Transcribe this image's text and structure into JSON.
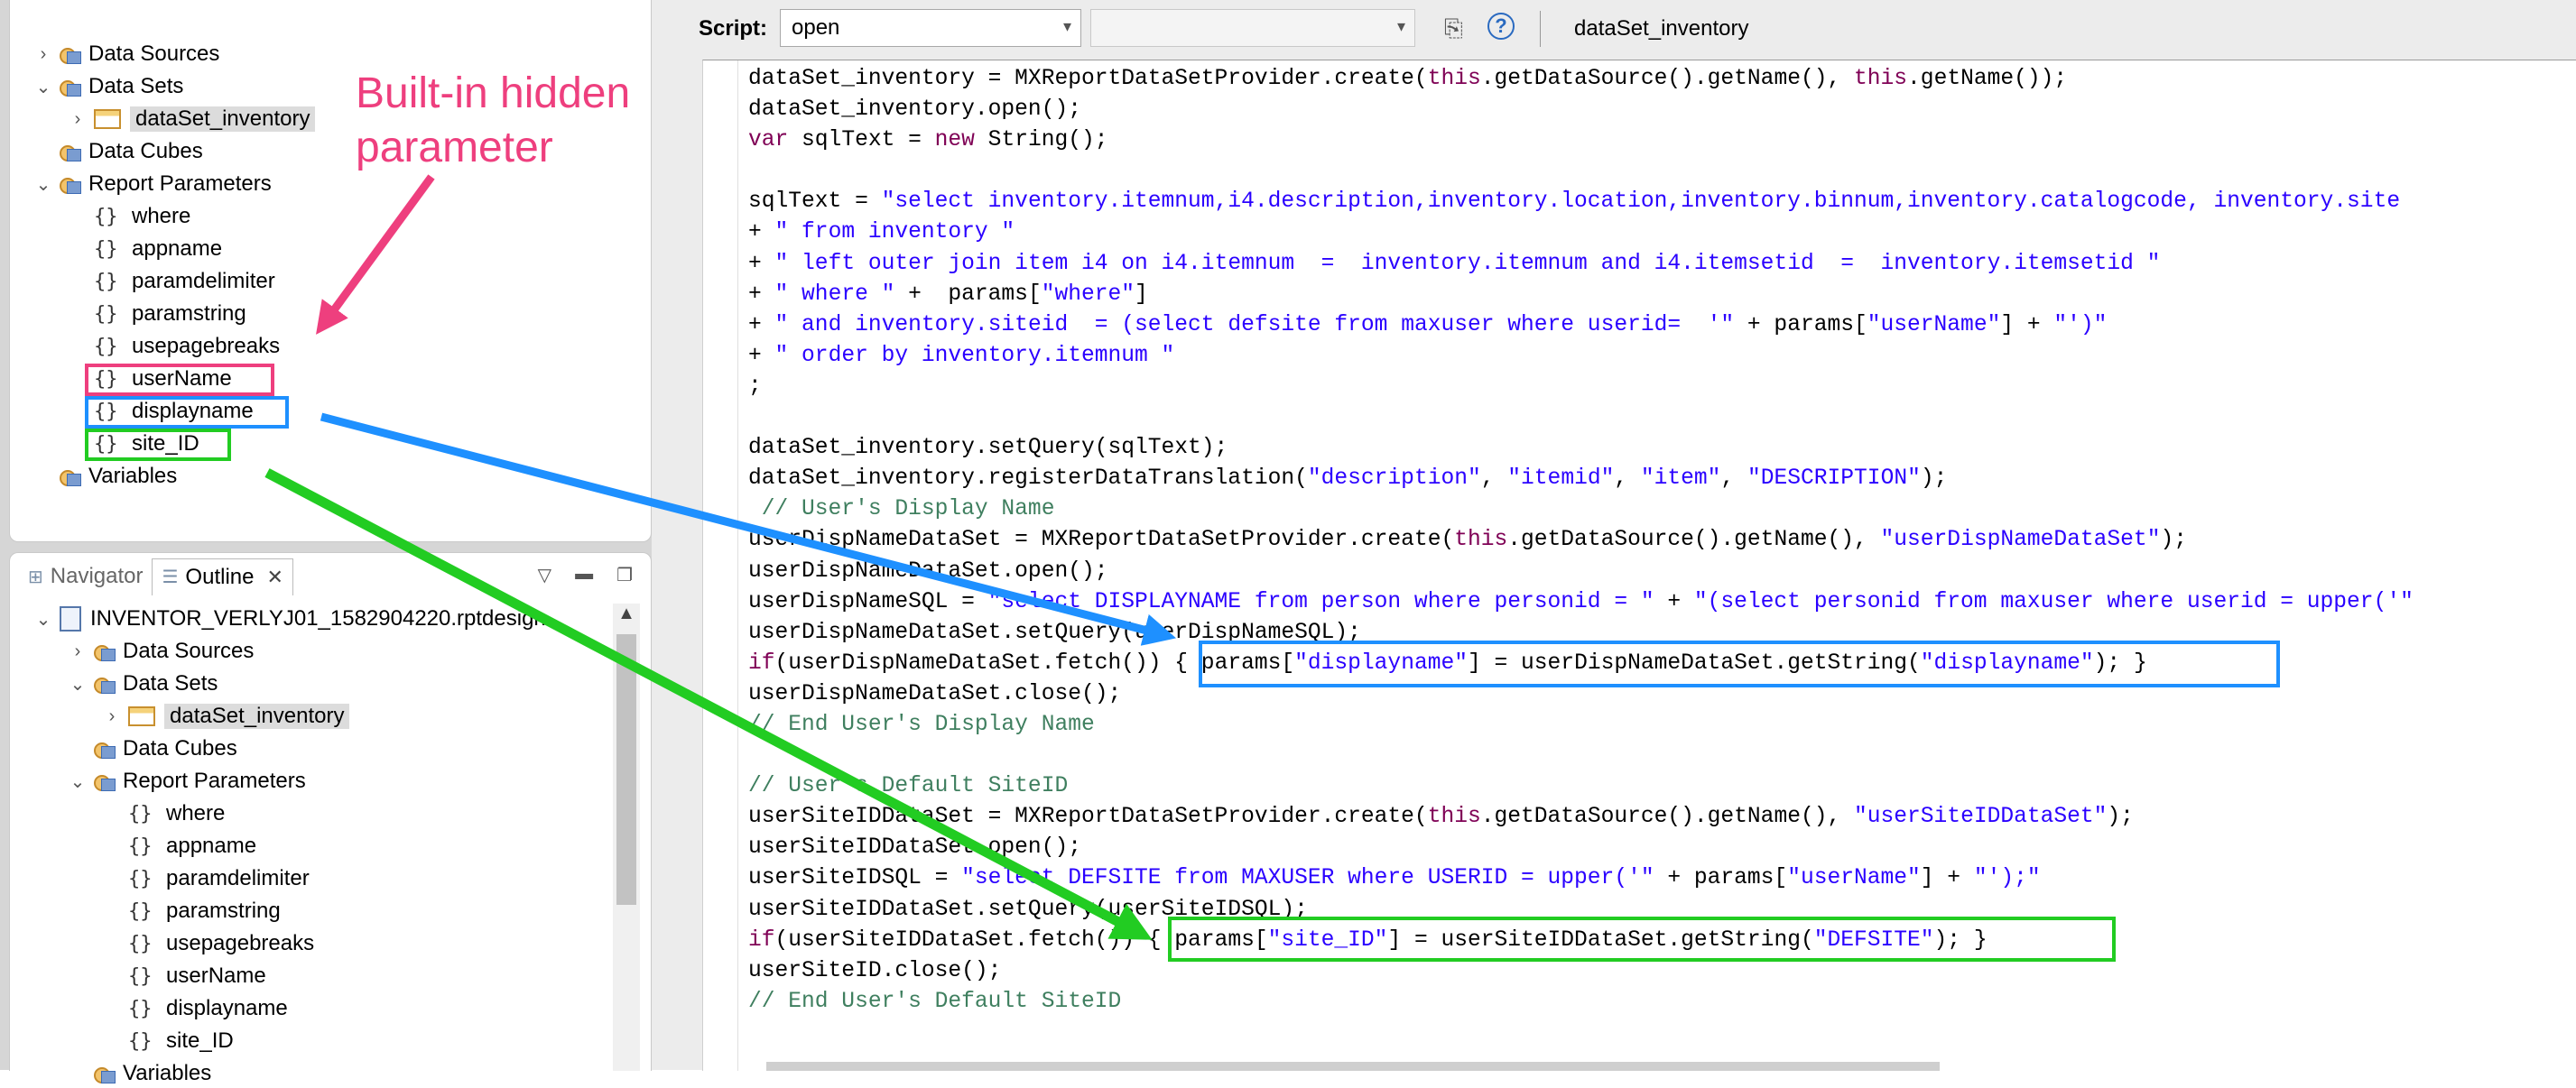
{
  "left_tree": {
    "items": [
      {
        "label": "Data Sources",
        "icon": "data-source-icon",
        "expander": "collapsed"
      },
      {
        "label": "Data Sets",
        "icon": "data-sets-icon",
        "expander": "expanded"
      },
      {
        "label": "dataSet_inventory",
        "icon": "table-icon",
        "expander": "collapsed",
        "selected": true
      },
      {
        "label": "Data Cubes",
        "icon": "data-cube-icon"
      },
      {
        "label": "Report Parameters",
        "icon": "report-parameters-icon",
        "expander": "expanded"
      },
      {
        "label": "where",
        "icon": "parameter-icon"
      },
      {
        "label": "appname",
        "icon": "parameter-icon"
      },
      {
        "label": "paramdelimiter",
        "icon": "parameter-icon"
      },
      {
        "label": "paramstring",
        "icon": "parameter-icon"
      },
      {
        "label": "usepagebreaks",
        "icon": "parameter-icon"
      },
      {
        "label": "userName",
        "icon": "parameter-icon",
        "highlight": "#ee3f7e"
      },
      {
        "label": "displayname",
        "icon": "parameter-icon",
        "highlight": "#1e90ff"
      },
      {
        "label": "site_ID",
        "icon": "parameter-icon",
        "highlight": "#22cc22"
      },
      {
        "label": "Variables",
        "icon": "variables-icon"
      }
    ]
  },
  "annotation": {
    "line1": "Built-in hidden",
    "line2": "parameter",
    "color": "#ee3f7e"
  },
  "nav_panel": {
    "tabs": [
      {
        "label": "Navigator",
        "icon": "navigator-icon",
        "active": false
      },
      {
        "label": "Outline",
        "icon": "outline-icon",
        "active": true,
        "close": "✕"
      }
    ],
    "tree": [
      {
        "label": "INVENTOR_VERLYJ01_1582904220.rptdesign",
        "icon": "report-file-icon",
        "expander": "expanded"
      },
      {
        "label": "Data Sources",
        "icon": "data-source-icon",
        "expander": "collapsed"
      },
      {
        "label": "Data Sets",
        "icon": "data-sets-icon",
        "expander": "expanded"
      },
      {
        "label": "dataSet_inventory",
        "icon": "table-icon",
        "expander": "collapsed",
        "selected": true
      },
      {
        "label": "Data Cubes",
        "icon": "data-cube-icon"
      },
      {
        "label": "Report Parameters",
        "icon": "report-parameters-icon",
        "expander": "expanded"
      },
      {
        "label": "where",
        "icon": "parameter-icon"
      },
      {
        "label": "appname",
        "icon": "parameter-icon"
      },
      {
        "label": "paramdelimiter",
        "icon": "parameter-icon"
      },
      {
        "label": "paramstring",
        "icon": "parameter-icon"
      },
      {
        "label": "usepagebreaks",
        "icon": "parameter-icon"
      },
      {
        "label": "userName",
        "icon": "parameter-icon"
      },
      {
        "label": "displayname",
        "icon": "parameter-icon"
      },
      {
        "label": "site_ID",
        "icon": "parameter-icon"
      },
      {
        "label": "Variables",
        "icon": "variables-icon"
      }
    ]
  },
  "toolbar": {
    "script_label": "Script:",
    "script_value": "open",
    "method_value": "",
    "dataset_name": "dataSet_inventory",
    "help_glyph": "?"
  },
  "code_lines": [
    [
      {
        "t": "dataSet_inventory = MXReportDataSetProvider.create("
      },
      {
        "t": "this",
        "c": "kw"
      },
      {
        "t": ".getDataSource().getName(), "
      },
      {
        "t": "this",
        "c": "kw"
      },
      {
        "t": ".getName());"
      }
    ],
    [
      {
        "t": "dataSet_inventory.open();"
      }
    ],
    [
      {
        "t": "var",
        "c": "kw"
      },
      {
        "t": " sqlText = "
      },
      {
        "t": "new",
        "c": "kw"
      },
      {
        "t": " String();"
      }
    ],
    [],
    [
      {
        "t": "sqlText = "
      },
      {
        "t": "\"select inventory.itemnum,i4.description,inventory.location,inventory.binnum,inventory.catalogcode, inventory.site",
        "c": "str"
      }
    ],
    [
      {
        "t": "+ "
      },
      {
        "t": "\" from inventory \"",
        "c": "str"
      }
    ],
    [
      {
        "t": "+ "
      },
      {
        "t": "\" left outer join item i4 on i4.itemnum  =  inventory.itemnum and i4.itemsetid  =  inventory.itemsetid \"",
        "c": "str"
      }
    ],
    [
      {
        "t": "+ "
      },
      {
        "t": "\" where \"",
        "c": "str"
      },
      {
        "t": " +  params["
      },
      {
        "t": "\"where\"",
        "c": "str"
      },
      {
        "t": "]"
      }
    ],
    [
      {
        "t": "+ "
      },
      {
        "t": "\" and inventory.siteid  = (select defsite from maxuser where userid=  '\"",
        "c": "str"
      },
      {
        "t": " + params["
      },
      {
        "t": "\"userName\"",
        "c": "str"
      },
      {
        "t": "] + "
      },
      {
        "t": "\"')\"",
        "c": "str"
      }
    ],
    [
      {
        "t": "+ "
      },
      {
        "t": "\" order by inventory.itemnum \"",
        "c": "str"
      }
    ],
    [
      {
        "t": ";"
      }
    ],
    [],
    [
      {
        "t": "dataSet_inventory.setQuery(sqlText);"
      }
    ],
    [
      {
        "t": "dataSet_inventory.registerDataTranslation("
      },
      {
        "t": "\"description\"",
        "c": "str"
      },
      {
        "t": ", "
      },
      {
        "t": "\"itemid\"",
        "c": "str"
      },
      {
        "t": ", "
      },
      {
        "t": "\"item\"",
        "c": "str"
      },
      {
        "t": ", "
      },
      {
        "t": "\"DESCRIPTION\"",
        "c": "str"
      },
      {
        "t": ");"
      }
    ],
    [
      {
        "t": " // User's Display Name",
        "c": "cmt"
      }
    ],
    [
      {
        "t": "userDispNameDataSet = MXReportDataSetProvider.create("
      },
      {
        "t": "this",
        "c": "kw"
      },
      {
        "t": ".getDataSource().getName(), "
      },
      {
        "t": "\"userDispNameDataSet\"",
        "c": "str"
      },
      {
        "t": ");"
      }
    ],
    [
      {
        "t": "userDispNameDataSet.open();"
      }
    ],
    [
      {
        "t": "userDispNameSQL = "
      },
      {
        "t": "\"select DISPLAYNAME from person where personid = \"",
        "c": "str"
      },
      {
        "t": " + "
      },
      {
        "t": "\"(select personid from maxuser where userid = upper('\"",
        "c": "str"
      }
    ],
    [
      {
        "t": "userDispNameDataSet.setQuery(userDispNameSQL);"
      }
    ],
    [
      {
        "t": "if",
        "c": "kw"
      },
      {
        "t": "(userDispNameDataSet.fetch()) { params["
      },
      {
        "t": "\"displayname\"",
        "c": "str"
      },
      {
        "t": "] = userDispNameDataSet.getString("
      },
      {
        "t": "\"displayname\"",
        "c": "str"
      },
      {
        "t": "); }"
      }
    ],
    [
      {
        "t": "userDispNameDataSet.close();"
      }
    ],
    [
      {
        "t": "// End User's Display Name",
        "c": "cmt"
      }
    ],
    [],
    [
      {
        "t": "// User's Default SiteID",
        "c": "cmt"
      }
    ],
    [
      {
        "t": "userSiteIDDataSet = MXReportDataSetProvider.create("
      },
      {
        "t": "this",
        "c": "kw"
      },
      {
        "t": ".getDataSource().getName(), "
      },
      {
        "t": "\"userSiteIDDataSet\"",
        "c": "str"
      },
      {
        "t": ");"
      }
    ],
    [
      {
        "t": "userSiteIDDataSet.open();"
      }
    ],
    [
      {
        "t": "userSiteIDSQL = "
      },
      {
        "t": "\"select DEFSITE from MAXUSER where USERID = upper('\"",
        "c": "str"
      },
      {
        "t": " + params["
      },
      {
        "t": "\"userName\"",
        "c": "str"
      },
      {
        "t": "] + "
      },
      {
        "t": "\"');\"",
        "c": "str"
      }
    ],
    [
      {
        "t": "userSiteIDDataSet.setQuery(userSiteIDSQL);"
      }
    ],
    [
      {
        "t": "if",
        "c": "kw"
      },
      {
        "t": "(userSiteIDDataSet.fetch()) { params["
      },
      {
        "t": "\"site_ID\"",
        "c": "str"
      },
      {
        "t": "] = userSiteIDDataSet.getString("
      },
      {
        "t": "\"DEFSITE\"",
        "c": "str"
      },
      {
        "t": "); }"
      }
    ],
    [
      {
        "t": "userSiteID.close();"
      }
    ],
    [
      {
        "t": "// End User's Default SiteID",
        "c": "cmt"
      }
    ]
  ],
  "highlight_colors": {
    "pink": "#ee3f7e",
    "blue": "#1e90ff",
    "green": "#22cc22"
  }
}
